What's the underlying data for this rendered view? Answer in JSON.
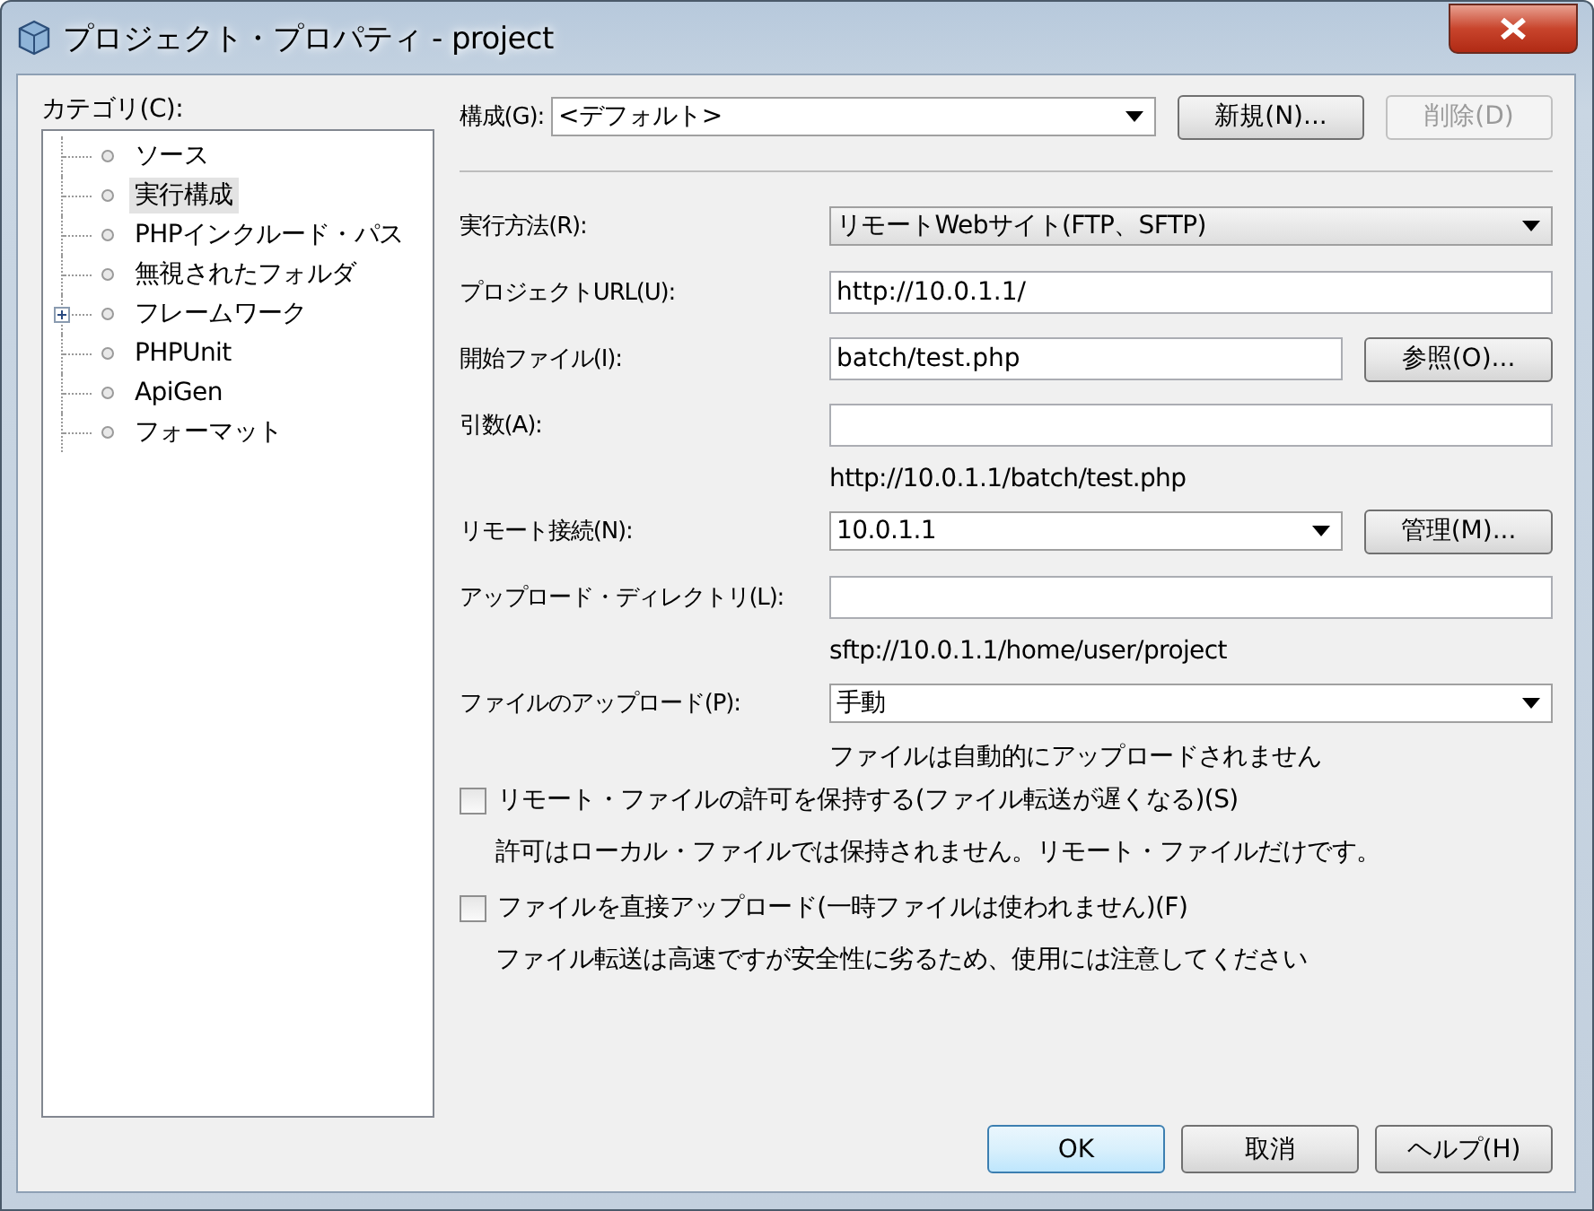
{
  "window": {
    "title": "プロジェクト・プロパティ - project"
  },
  "category_label": "カテゴリ(C):",
  "categories": [
    {
      "label": "ソース",
      "selected": false,
      "has_children": false
    },
    {
      "label": "実行構成",
      "selected": true,
      "has_children": false
    },
    {
      "label": "PHPインクルード・パス",
      "selected": false,
      "has_children": false
    },
    {
      "label": "無視されたフォルダ",
      "selected": false,
      "has_children": false
    },
    {
      "label": "フレームワーク",
      "selected": false,
      "has_children": true
    },
    {
      "label": "PHPUnit",
      "selected": false,
      "has_children": false
    },
    {
      "label": "ApiGen",
      "selected": false,
      "has_children": false
    },
    {
      "label": "フォーマット",
      "selected": false,
      "has_children": false
    }
  ],
  "configuration": {
    "label": "構成(G):",
    "value": "<デフォルト>",
    "buttons": [
      {
        "label": "新規(N)...",
        "disabled": false
      },
      {
        "label": "削除(D)",
        "disabled": true
      }
    ]
  },
  "rows": [
    {
      "kind": "combo",
      "label": "実行方法(R):",
      "value": "リモートWebサイト(FTP、SFTP)"
    },
    {
      "kind": "input",
      "label": "プロジェクトURL(U):",
      "value": "http://10.0.1.1/"
    },
    {
      "kind": "input",
      "label": "開始ファイル(I):",
      "value": "batch/test.php",
      "button": "参照(O)..."
    },
    {
      "kind": "input",
      "label": "引数(A):"
    },
    {
      "kind": "hint",
      "text": "http://10.0.1.1/batch/test.php"
    },
    {
      "kind": "combo",
      "label": "リモート接続(N):",
      "value": "10.0.1.1",
      "button": "管理(M)..."
    },
    {
      "kind": "input",
      "label": "アップロード・ディレクトリ(L):"
    },
    {
      "kind": "hint",
      "text": "sftp://10.0.1.1/home/user/project"
    },
    {
      "kind": "combo",
      "label": "ファイルのアップロード(P):",
      "value": "手動"
    },
    {
      "kind": "hint",
      "text": "ファイルは自動的にアップロードされません"
    }
  ],
  "checkboxes": [
    {
      "label": "リモート・ファイルの許可を保持する(ファイル転送が遅くなる)(S)",
      "checked": false,
      "description": "許可はローカル・ファイルでは保持されません。リモート・ファイルだけです。"
    },
    {
      "label": "ファイルを直接アップロード(一時ファイルは使われません)(F)",
      "checked": false,
      "description": "ファイル転送は高速ですが安全性に劣るため、使用には注意してください"
    }
  ],
  "buttons": [
    {
      "label": "OK",
      "default": true
    },
    {
      "label": "取消",
      "default": false
    },
    {
      "label": "ヘルプ(H)",
      "default": false
    }
  ]
}
